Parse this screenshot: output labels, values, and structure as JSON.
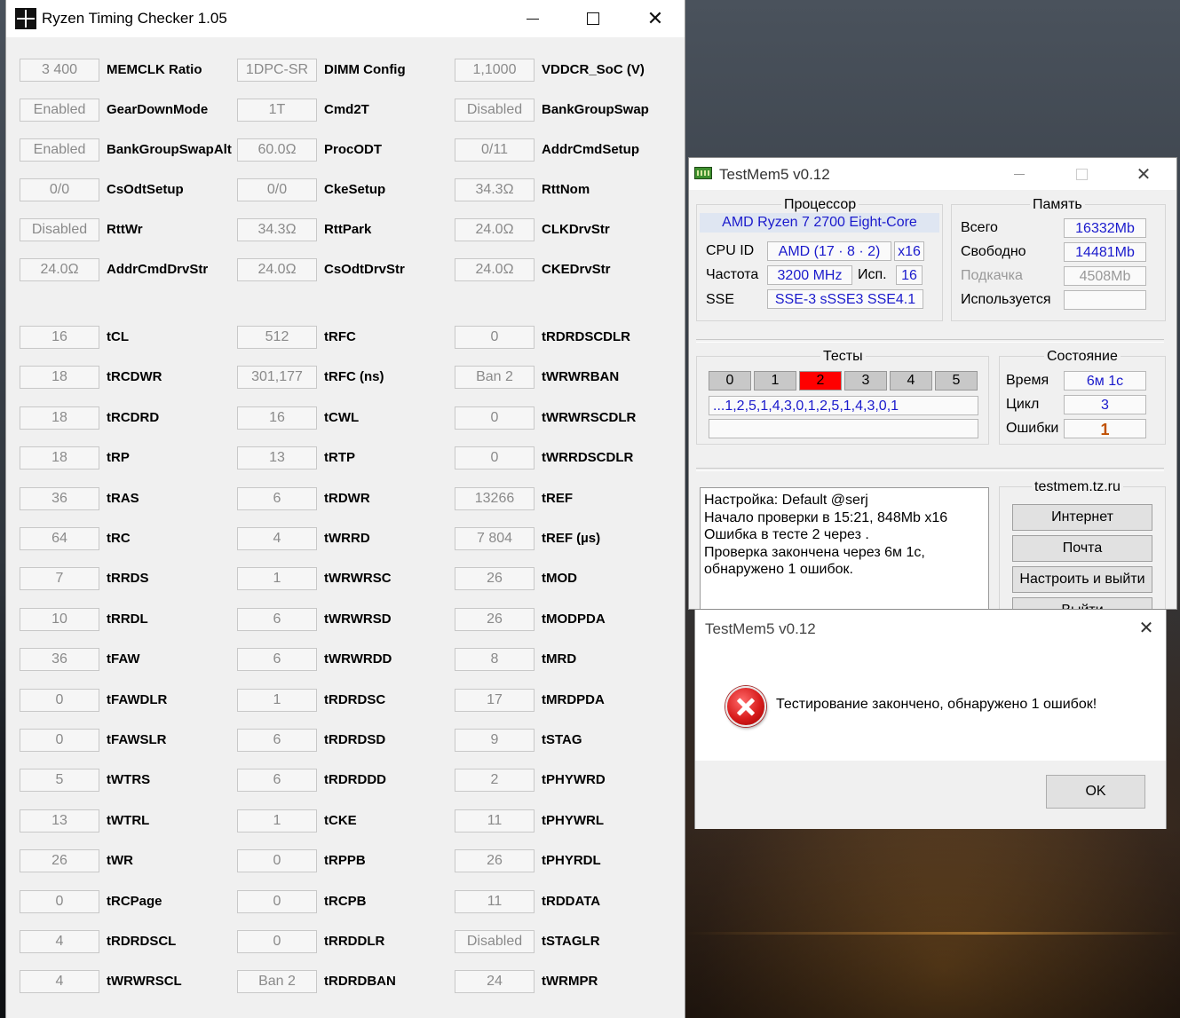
{
  "rtc": {
    "title": "Ryzen Timing Checker 1.05",
    "top": [
      [
        [
          "3 400",
          "MEMCLK Ratio"
        ],
        [
          "1DPC-SR",
          "DIMM Config"
        ],
        [
          "1,1000",
          "VDDCR_SoC (V)"
        ]
      ],
      [
        [
          "Enabled",
          "GearDownMode"
        ],
        [
          "1T",
          "Cmd2T"
        ],
        [
          "Disabled",
          "BankGroupSwap"
        ]
      ],
      [
        [
          "Enabled",
          "BankGroupSwapAlt"
        ],
        [
          "60.0Ω",
          "ProcODT"
        ],
        [
          "0/11",
          "AddrCmdSetup"
        ]
      ],
      [
        [
          "0/0",
          "CsOdtSetup"
        ],
        [
          "0/0",
          "CkeSetup"
        ],
        [
          "34.3Ω",
          "RttNom"
        ]
      ],
      [
        [
          "Disabled",
          "RttWr"
        ],
        [
          "34.3Ω",
          "RttPark"
        ],
        [
          "24.0Ω",
          "CLKDrvStr"
        ]
      ],
      [
        [
          "24.0Ω",
          "AddrCmdDrvStr"
        ],
        [
          "24.0Ω",
          "CsOdtDrvStr"
        ],
        [
          "24.0Ω",
          "CKEDrvStr"
        ]
      ]
    ],
    "timings": [
      [
        [
          "16",
          "tCL"
        ],
        [
          "512",
          "tRFC"
        ],
        [
          "0",
          "tRDRDSCDLR"
        ]
      ],
      [
        [
          "18",
          "tRCDWR"
        ],
        [
          "301,177",
          "tRFC (ns)"
        ],
        [
          "Ban 2",
          "tWRWRBAN"
        ]
      ],
      [
        [
          "18",
          "tRCDRD"
        ],
        [
          "16",
          "tCWL"
        ],
        [
          "0",
          "tWRWRSCDLR"
        ]
      ],
      [
        [
          "18",
          "tRP"
        ],
        [
          "13",
          "tRTP"
        ],
        [
          "0",
          "tWRRDSCDLR"
        ]
      ],
      [
        [
          "36",
          "tRAS"
        ],
        [
          "6",
          "tRDWR"
        ],
        [
          "13266",
          "tREF"
        ]
      ],
      [
        [
          "64",
          "tRC"
        ],
        [
          "4",
          "tWRRD"
        ],
        [
          "7 804",
          "tREF (µs)"
        ]
      ],
      [
        [
          "7",
          "tRRDS"
        ],
        [
          "1",
          "tWRWRSC"
        ],
        [
          "26",
          "tMOD"
        ]
      ],
      [
        [
          "10",
          "tRRDL"
        ],
        [
          "6",
          "tWRWRSD"
        ],
        [
          "26",
          "tMODPDA"
        ]
      ],
      [
        [
          "36",
          "tFAW"
        ],
        [
          "6",
          "tWRWRDD"
        ],
        [
          "8",
          "tMRD"
        ]
      ],
      [
        [
          "0",
          "tFAWDLR"
        ],
        [
          "1",
          "tRDRDSC"
        ],
        [
          "17",
          "tMRDPDA"
        ]
      ],
      [
        [
          "0",
          "tFAWSLR"
        ],
        [
          "6",
          "tRDRDSD"
        ],
        [
          "9",
          "tSTAG"
        ]
      ],
      [
        [
          "5",
          "tWTRS"
        ],
        [
          "6",
          "tRDRDDD"
        ],
        [
          "2",
          "tPHYWRD"
        ]
      ],
      [
        [
          "13",
          "tWTRL"
        ],
        [
          "1",
          "tCKE"
        ],
        [
          "11",
          "tPHYWRL"
        ]
      ],
      [
        [
          "26",
          "tWR"
        ],
        [
          "0",
          "tRPPB"
        ],
        [
          "26",
          "tPHYRDL"
        ]
      ],
      [
        [
          "0",
          "tRCPage"
        ],
        [
          "0",
          "tRCPB"
        ],
        [
          "11",
          "tRDDATA"
        ]
      ],
      [
        [
          "4",
          "tRDRDSCL"
        ],
        [
          "0",
          "tRRDDLR"
        ],
        [
          "Disabled",
          "tSTAGLR"
        ]
      ],
      [
        [
          "4",
          "tWRWRSCL"
        ],
        [
          "Ban 2",
          "tRDRDBAN"
        ],
        [
          "24",
          "tWRMPR"
        ]
      ]
    ]
  },
  "tm": {
    "title": "TestMem5 v0.12",
    "cpu_group": "Процессор",
    "cpu_name": "AMD Ryzen 7 2700 Eight-Core",
    "cpu_id_label": "CPU ID",
    "cpu_id": "AMD  (17 · 8 · 2)",
    "cpu_threads": "x16",
    "freq_label": "Частота",
    "freq": "3200 MHz",
    "isp_label": "Исп.",
    "isp": "16",
    "sse_label": "SSE",
    "sse": "SSE-3 sSSE3 SSE4.1",
    "mem_group": "Память",
    "mem_total_label": "Всего",
    "mem_total": "16332Mb",
    "mem_free_label": "Свободно",
    "mem_free": "14481Mb",
    "mem_swap_label": "Подкачка",
    "mem_swap": "4508Mb",
    "mem_used_label": "Используется",
    "mem_used": "",
    "tests_group": "Тесты",
    "tests": [
      "0",
      "1",
      "2",
      "3",
      "4",
      "5"
    ],
    "active_test": 2,
    "sequence": "...1,2,5,1,4,3,0,1,2,5,1,4,3,0,1",
    "state_group": "Состояние",
    "time_label": "Время",
    "time": "6м 1с",
    "cycle_label": "Цикл",
    "cycle": "3",
    "errors_label": "Ошибки",
    "errors": "1",
    "log": [
      "Настройка: Default @serj",
      "Начало проверки в 15:21, 848Mb x16",
      "Ошибка в тесте 2 через .",
      "Проверка закончена через 6м 1с,",
      "обнаружено 1 ошибок."
    ],
    "site": "testmem.tz.ru",
    "btn_internet": "Интернет",
    "btn_mail": "Почта",
    "btn_config_exit": "Настроить и выйти",
    "btn_exit": "Выйти"
  },
  "dialog": {
    "title": "TestMem5 v0.12",
    "message": "Тестирование закончено, обнаружено 1 ошибок!",
    "ok": "OK"
  },
  "colors": {
    "active_test": "#ff0000",
    "value_blue": "#1a1acc",
    "errors": "#c05000"
  }
}
